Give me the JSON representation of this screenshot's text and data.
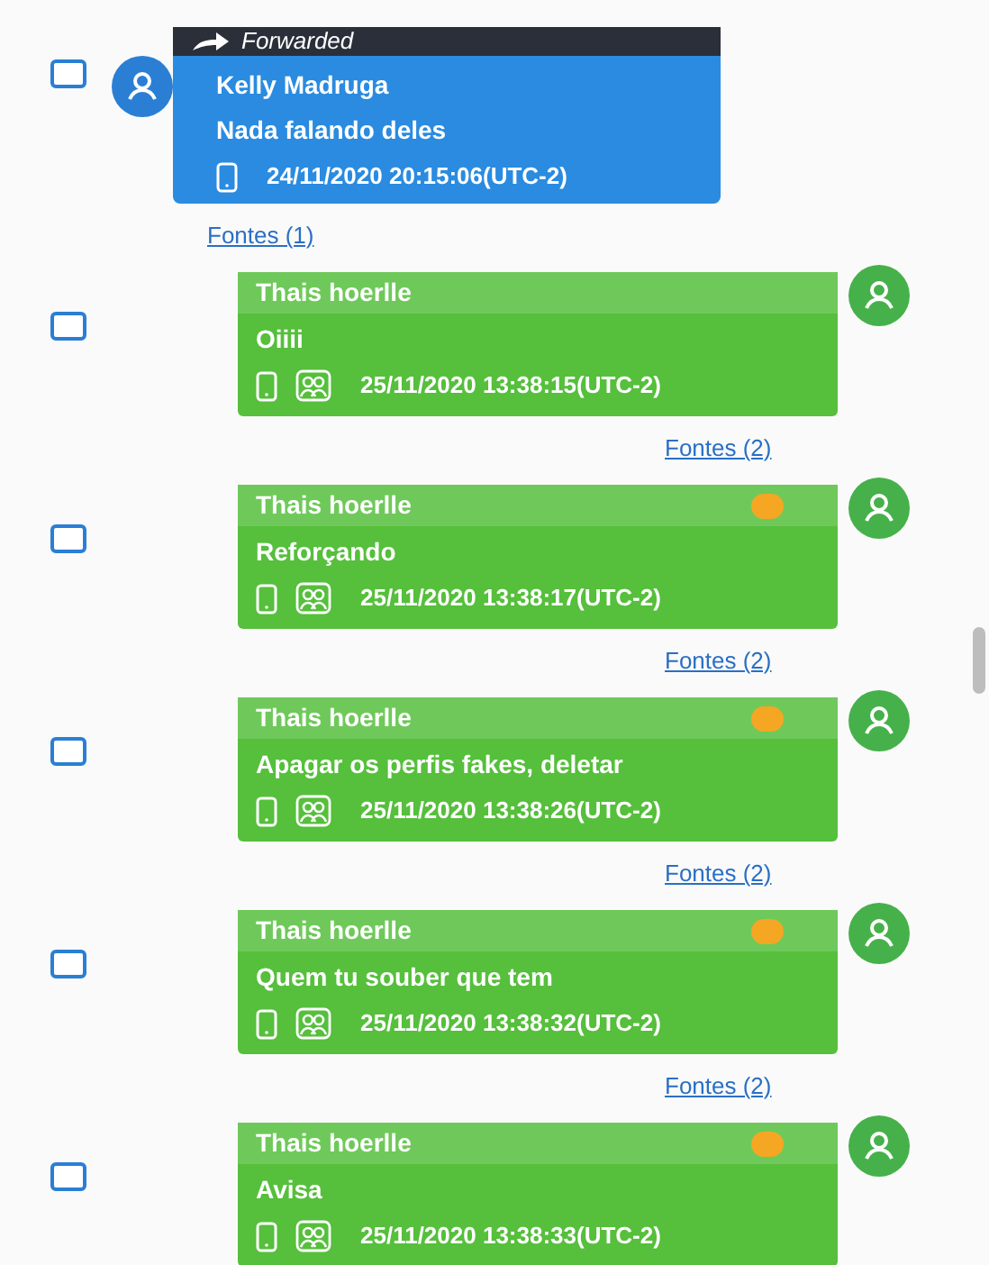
{
  "messages": [
    {
      "kind": "incoming",
      "checked": false,
      "forwarded_label": "Forwarded",
      "sender": "Kelly Madruga",
      "text": "Nada falando deles",
      "timestamp": "24/11/2020 20:15:06(UTC-2)",
      "group": false,
      "flagged": false,
      "sources": "Fontes (1)"
    },
    {
      "kind": "outgoing",
      "checked": false,
      "sender": "Thais hoerlle",
      "text": "Oiiii",
      "timestamp": "25/11/2020 13:38:15(UTC-2)",
      "group": true,
      "flagged": false,
      "sources": "Fontes (2)"
    },
    {
      "kind": "outgoing",
      "checked": false,
      "sender": "Thais hoerlle",
      "text": "Reforçando",
      "timestamp": "25/11/2020 13:38:17(UTC-2)",
      "group": true,
      "flagged": true,
      "sources": "Fontes (2)"
    },
    {
      "kind": "outgoing",
      "checked": false,
      "sender": "Thais hoerlle",
      "text": "Apagar os perfis fakes, deletar",
      "timestamp": "25/11/2020 13:38:26(UTC-2)",
      "group": true,
      "flagged": true,
      "sources": "Fontes (2)"
    },
    {
      "kind": "outgoing",
      "checked": false,
      "sender": "Thais hoerlle",
      "text": "Quem tu souber que tem",
      "timestamp": "25/11/2020 13:38:32(UTC-2)",
      "group": true,
      "flagged": true,
      "sources": "Fontes (2)"
    },
    {
      "kind": "outgoing",
      "checked": false,
      "sender": "Thais hoerlle",
      "text": "Avisa",
      "timestamp": "25/11/2020 13:38:33(UTC-2)",
      "group": true,
      "flagged": true
    }
  ]
}
